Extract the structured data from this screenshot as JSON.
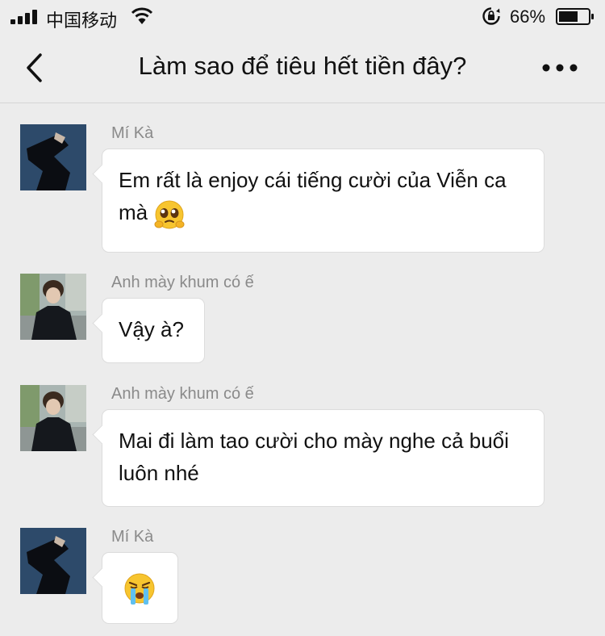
{
  "status_bar": {
    "carrier": "中国移动",
    "battery_percent": "66%",
    "battery_level": 0.66
  },
  "header": {
    "back_icon": "chevron-left-icon",
    "title": "Làm sao để tiêu hết tiền đây?",
    "more_icon": "more-dots-icon"
  },
  "messages": [
    {
      "sender": "Mí Kà",
      "text": "Em rất là enjoy cái tiếng cười của Viễn ca mà",
      "emoji": "pleading-face"
    },
    {
      "sender": "Anh mày khum có ế",
      "text": "Vậy à?"
    },
    {
      "sender": "Anh mày khum có ế",
      "text": "Mai đi làm tao cười cho mày nghe cả buổi luôn nhé"
    },
    {
      "sender": "Mí Kà",
      "text": "",
      "emoji": "crying-face"
    }
  ],
  "colors": {
    "background": "#ececec",
    "bubble": "#ffffff",
    "sender_name": "#8a8a8a"
  }
}
